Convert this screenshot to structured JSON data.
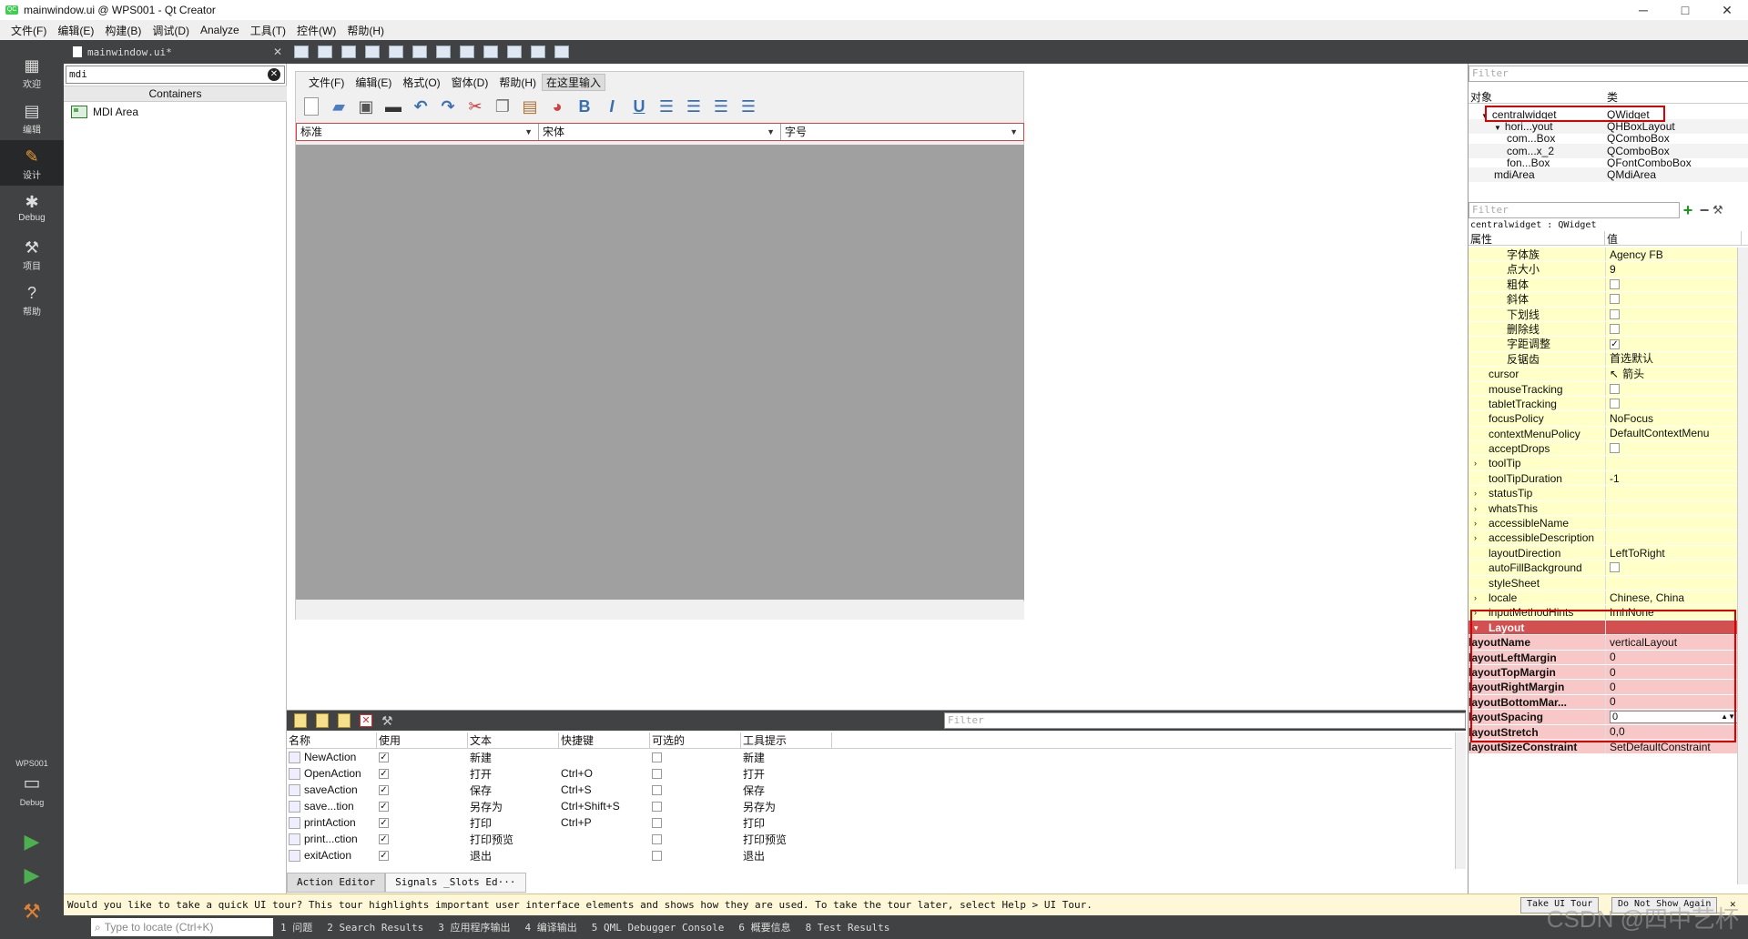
{
  "window": {
    "title": "mainwindow.ui @ WPS001 - Qt Creator",
    "app_icon": "QC",
    "minimize": "─",
    "maximize": "□",
    "close": "✕"
  },
  "menubar": [
    "文件(F)",
    "编辑(E)",
    "构建(B)",
    "调试(D)",
    "Analyze",
    "工具(T)",
    "控件(W)",
    "帮助(H)"
  ],
  "modes": [
    {
      "label": "欢迎",
      "icon": "grid-icon"
    },
    {
      "label": "编辑",
      "icon": "edit-icon"
    },
    {
      "label": "设计",
      "icon": "pencil-icon",
      "active": true
    },
    {
      "label": "Debug",
      "icon": "bug-icon"
    },
    {
      "label": "项目",
      "icon": "wrench-icon"
    },
    {
      "label": "帮助",
      "icon": "help-icon"
    }
  ],
  "kit": {
    "project": "WPS001",
    "mode": "Debug"
  },
  "editor": {
    "file": "mainwindow.ui*"
  },
  "widgetbox": {
    "filter": "mdi",
    "category": "Containers",
    "item": "MDI Area"
  },
  "form": {
    "menu": [
      "文件(F)",
      "编辑(E)",
      "格式(O)",
      "窗体(D)",
      "帮助(H)"
    ],
    "menu_type_here": "在这里输入",
    "combos": [
      "标准",
      "宋体",
      "字号"
    ],
    "toolbar_glyphs": {
      "bold": "B",
      "italic": "I",
      "underline": "U"
    }
  },
  "action_editor": {
    "filter_placeholder": "Filter",
    "headers": [
      "名称",
      "使用",
      "文本",
      "快捷键",
      "可选的",
      "工具提示"
    ],
    "rows": [
      {
        "name": "NewAction",
        "used": "✓",
        "text": "新建",
        "shortcut": "",
        "checkable": "",
        "tip": "新建"
      },
      {
        "name": "OpenAction",
        "used": "✓",
        "text": "打开",
        "shortcut": "Ctrl+O",
        "checkable": "",
        "tip": "打开"
      },
      {
        "name": "saveAction",
        "used": "✓",
        "text": "保存",
        "shortcut": "Ctrl+S",
        "checkable": "",
        "tip": "保存"
      },
      {
        "name": "save...tion",
        "used": "✓",
        "text": "另存为",
        "shortcut": "Ctrl+Shift+S",
        "checkable": "",
        "tip": "另存为"
      },
      {
        "name": "printAction",
        "used": "✓",
        "text": "打印",
        "shortcut": "Ctrl+P",
        "checkable": "",
        "tip": "打印"
      },
      {
        "name": "print...ction",
        "used": "✓",
        "text": "打印预览",
        "shortcut": "",
        "checkable": "",
        "tip": "打印预览"
      },
      {
        "name": "exitAction",
        "used": "✓",
        "text": "退出",
        "shortcut": "",
        "checkable": "",
        "tip": "退出"
      }
    ],
    "tabs": [
      "Action Editor",
      "Signals _Slots Ed···"
    ]
  },
  "object_inspector": {
    "filter_placeholder": "Filter",
    "headers": [
      "对象",
      "类"
    ],
    "rows": [
      {
        "obj": "centralwidget",
        "cls": "QWidget",
        "indent": 1
      },
      {
        "obj": "hori...yout",
        "cls": "QHBoxLayout",
        "indent": 2
      },
      {
        "obj": "com...Box",
        "cls": "QComboBox",
        "indent": 3
      },
      {
        "obj": "com...x_2",
        "cls": "QComboBox",
        "indent": 3
      },
      {
        "obj": "fon...Box",
        "cls": "QFontComboBox",
        "indent": 3
      },
      {
        "obj": "mdiArea",
        "cls": "QMdiArea",
        "indent": 2
      }
    ]
  },
  "property_editor": {
    "filter_placeholder": "Filter",
    "class_label": "centralwidget : QWidget",
    "headers": [
      "属性",
      "值"
    ],
    "rows": [
      {
        "k": "字体族",
        "v": "Agency FB",
        "kind": "sub"
      },
      {
        "k": "点大小",
        "v": "9",
        "kind": "sub"
      },
      {
        "k": "粗体",
        "v": "",
        "cb": "",
        "kind": "sub"
      },
      {
        "k": "斜体",
        "v": "",
        "cb": "",
        "kind": "sub"
      },
      {
        "k": "下划线",
        "v": "",
        "cb": "",
        "kind": "sub"
      },
      {
        "k": "删除线",
        "v": "",
        "cb": "",
        "kind": "sub"
      },
      {
        "k": "字距调整",
        "v": "",
        "cb": "✓",
        "kind": "sub"
      },
      {
        "k": "反锯齿",
        "v": "首选默认",
        "kind": "sub"
      },
      {
        "k": "cursor",
        "v": "箭头",
        "kind": "top"
      },
      {
        "k": "mouseTracking",
        "v": "",
        "cb": "",
        "kind": "top"
      },
      {
        "k": "tabletTracking",
        "v": "",
        "cb": "",
        "kind": "top"
      },
      {
        "k": "focusPolicy",
        "v": "NoFocus",
        "kind": "top"
      },
      {
        "k": "contextMenuPolicy",
        "v": "DefaultContextMenu",
        "kind": "top"
      },
      {
        "k": "acceptDrops",
        "v": "",
        "cb": "",
        "kind": "top"
      },
      {
        "k": "toolTip",
        "v": "",
        "kind": "top",
        "exp": "›"
      },
      {
        "k": "toolTipDuration",
        "v": "-1",
        "kind": "top"
      },
      {
        "k": "statusTip",
        "v": "",
        "kind": "top",
        "exp": "›"
      },
      {
        "k": "whatsThis",
        "v": "",
        "kind": "top",
        "exp": "›"
      },
      {
        "k": "accessibleName",
        "v": "",
        "kind": "top",
        "exp": "›"
      },
      {
        "k": "accessibleDescription",
        "v": "",
        "kind": "top",
        "exp": "›"
      },
      {
        "k": "layoutDirection",
        "v": "LeftToRight",
        "kind": "top"
      },
      {
        "k": "autoFillBackground",
        "v": "",
        "cb": "",
        "kind": "top"
      },
      {
        "k": "styleSheet",
        "v": "",
        "kind": "top"
      },
      {
        "k": "locale",
        "v": "Chinese, China",
        "kind": "top",
        "exp": "›"
      },
      {
        "k": "inputMethodHints",
        "v": "ImhNone",
        "kind": "top",
        "exp": "›"
      },
      {
        "k": "Layout",
        "v": "",
        "kind": "section",
        "exp": "▾"
      },
      {
        "k": "layoutName",
        "v": "verticalLayout",
        "kind": "layout"
      },
      {
        "k": "layoutLeftMargin",
        "v": "0",
        "kind": "layout"
      },
      {
        "k": "layoutTopMargin",
        "v": "0",
        "kind": "layout"
      },
      {
        "k": "layoutRightMargin",
        "v": "0",
        "kind": "layout"
      },
      {
        "k": "layoutBottomMar...",
        "v": "0",
        "kind": "layout"
      },
      {
        "k": "layoutSpacing",
        "v": "0",
        "kind": "layout",
        "spin": true
      },
      {
        "k": "layoutStretch",
        "v": "0,0",
        "kind": "layout"
      },
      {
        "k": "layoutSizeConstraint",
        "v": "SetDefaultConstraint",
        "kind": "layout"
      }
    ]
  },
  "tour": {
    "message": "Would you like to take a quick UI tour? This tour highlights important user interface elements and shows how they are used. To take the tour later, select Help > UI Tour.",
    "take": "Take UI Tour",
    "dont": "Do Not Show Again"
  },
  "statusbar": {
    "locate_placeholder": "Type to locate (Ctrl+K)",
    "tabs": [
      "1 问题",
      "2 Search Results",
      "3 应用程序输出",
      "4 编译输出",
      "5 QML Debugger Console",
      "6 概要信息",
      "8 Test Results"
    ]
  },
  "watermark": "CSDN @四中艺杯"
}
